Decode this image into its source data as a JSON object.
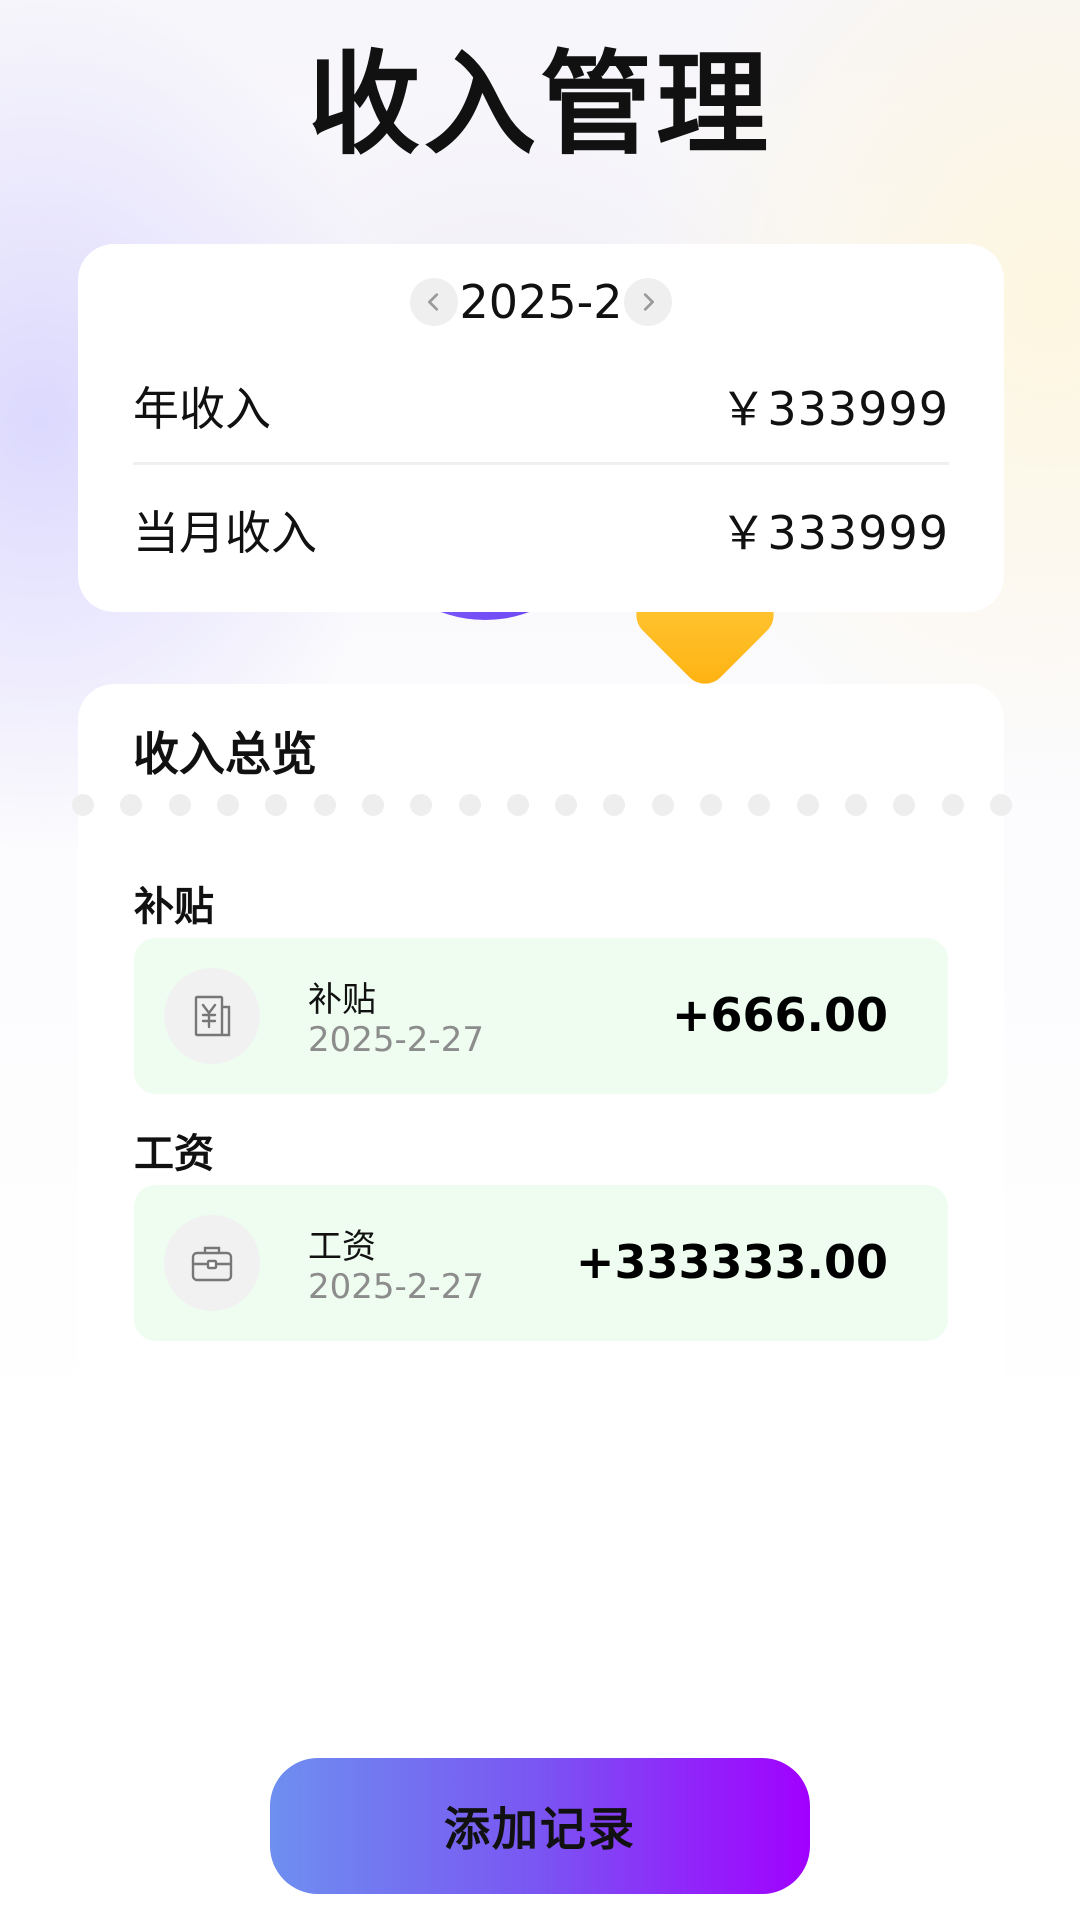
{
  "page": {
    "title": "收入管理"
  },
  "summary": {
    "month": "2025-2",
    "prev_icon": "chevron-left-icon",
    "next_icon": "chevron-right-icon",
    "rows": [
      {
        "label": "年收入",
        "value": "￥333999"
      },
      {
        "label": "当月收入",
        "value": "￥333999"
      }
    ]
  },
  "overview": {
    "title": "收入总览",
    "groups": [
      {
        "title": "补贴",
        "records": [
          {
            "icon": "receipt-yuan-icon",
            "name": "补贴",
            "date": "2025-2-27",
            "amount": "+666.00"
          }
        ]
      },
      {
        "title": "工资",
        "records": [
          {
            "icon": "briefcase-icon",
            "name": "工资",
            "date": "2025-2-27",
            "amount": "+333333.00"
          }
        ]
      }
    ]
  },
  "actions": {
    "add_label": "添加记录"
  },
  "colors": {
    "record_bg": "#eefdf0",
    "button_gradient_start": "#6e8ff0",
    "button_gradient_end": "#a100ff",
    "decor_purple": "#7a55f2",
    "decor_yellow": "#ffc21f"
  }
}
